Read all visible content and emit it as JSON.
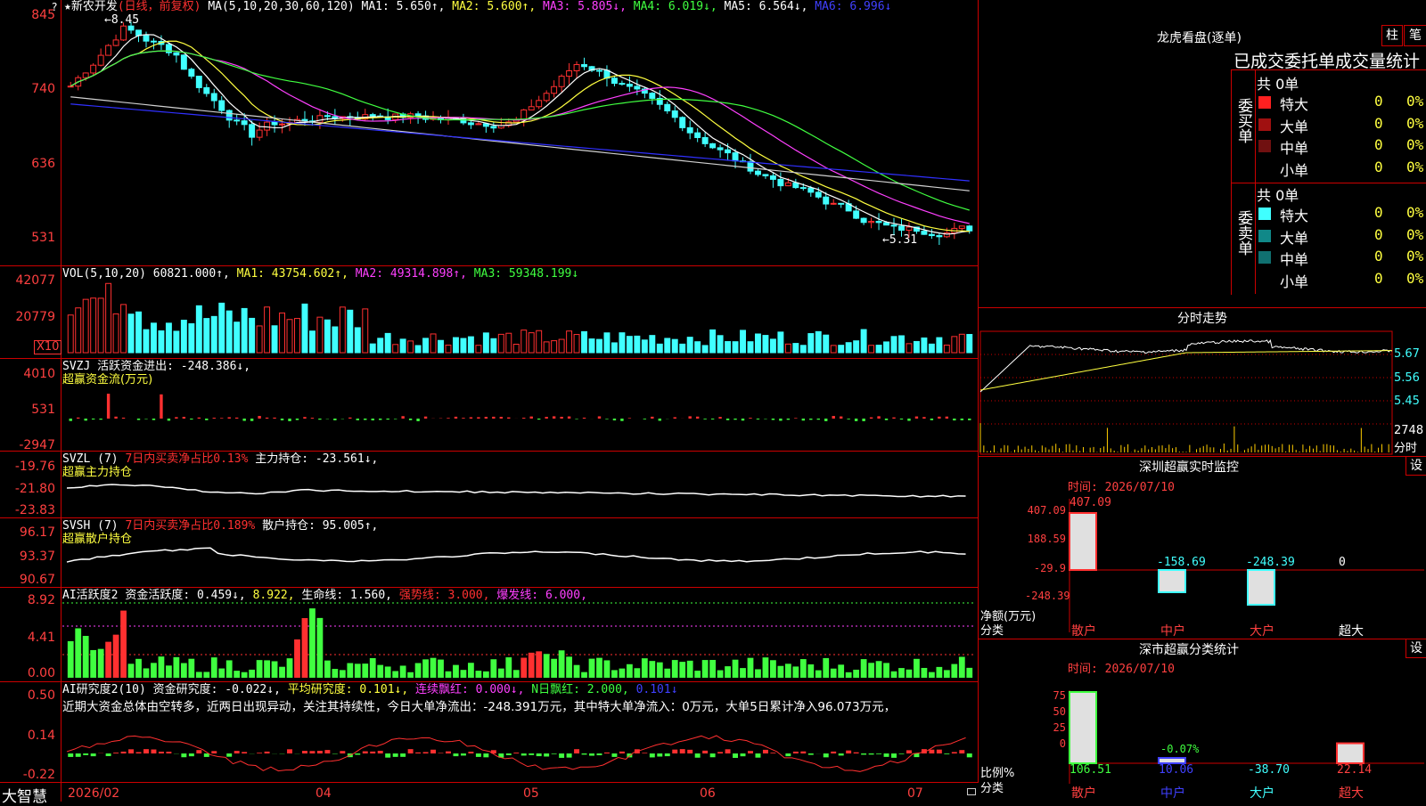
{
  "app": {
    "logo": "大智慧",
    "lock_icon": "lock-icon"
  },
  "header": {
    "stock": "★新农开发",
    "period": "(日线，前复权)",
    "ma_label": "MA(5,10,20,30,60,120)",
    "ma1": "MA1: 5.650↑,",
    "ma2": "MA2: 5.600↑,",
    "ma3": "MA3: 5.805↓,",
    "ma4": "MA4: 6.019↓,",
    "ma5": "MA5: 6.564↓,",
    "ma6": "MA6: 6.996↓",
    "help": "?"
  },
  "price_panel": {
    "ticks": [
      "845",
      "740",
      "636",
      "531"
    ],
    "high_label": "←8.45",
    "low_label": "←5.31"
  },
  "vol_panel": {
    "title": "VOL(5,10,20)",
    "value": "60821.000↑,",
    "ma1": "MA1: 43754.602↑,",
    "ma2": "MA2: 49314.898↑,",
    "ma3": "MA3: 59348.199↓",
    "ticks": [
      "42077",
      "20779"
    ],
    "unit": "X10"
  },
  "svzj": {
    "title": "SVZJ",
    "desc": "活跃资金进出: -248.386↓,",
    "sub": "超赢资金流(万元)",
    "ticks": [
      "4010",
      "531",
      "-2947"
    ]
  },
  "svzl": {
    "title": "SVZL (7)",
    "desc": "7日内买卖净占比0.13%",
    "value": "主力持仓: -23.561↓,",
    "sub": "超赢主力持仓",
    "ticks": [
      "-19.76",
      "-21.80",
      "-23.83"
    ]
  },
  "svsh": {
    "title": "SVSH (7)",
    "desc": "7日内买卖净占比0.189%",
    "value": "散户持仓: 95.005↑,",
    "sub": "超赢散户持仓",
    "ticks": [
      "96.17",
      "93.37",
      "90.67"
    ]
  },
  "ai_act": {
    "title": "AI活跃度2",
    "a": "资金活跃度: 0.459↓,",
    "b": "8.922,",
    "c": "生命线: 1.560,",
    "d": "强势线: 3.000,",
    "e": "爆发线: 6.000,",
    "ticks": [
      "8.92",
      "4.41",
      "0.00"
    ]
  },
  "ai_res": {
    "title": "AI研究度2(10)",
    "a": "资金研究度: -0.022↓,",
    "b": "平均研究度: 0.101↓,",
    "c": "连续飘红: 0.000↓,",
    "d": "N日飘红: 2.000,",
    "e": "0.101↓",
    "note": "近期大资金总体由空转多，近两日出现异动，关注其持续性，今日大单净流出：-248.391万元，其中特大单净流入：0万元，大单5日累计净入96.073万元，",
    "ticks": [
      "0.50",
      "0.14",
      "-0.22"
    ]
  },
  "xaxis": [
    "2026/02",
    "04",
    "05",
    "06",
    "07"
  ],
  "lhb": {
    "title": "龙虎看盘(逐单)",
    "btn1": "柱",
    "btn2": "笔",
    "heading": "已成交委托单成交量统计",
    "buy_side": "委买单",
    "sell_side": "委卖单",
    "buy_total": "共 0单",
    "sell_total": "共 0单",
    "rows": [
      "特大",
      "大单",
      "中单",
      "小单"
    ],
    "zero": "0",
    "pct": "0%"
  },
  "fenshi": {
    "title": "分时走势",
    "ticks": [
      "5.67",
      "5.56",
      "5.45"
    ],
    "vol": "2748",
    "vol_unit": "分时"
  },
  "szmon": {
    "title": "深圳超赢实时监控",
    "btn": "设",
    "time": "时间: 2026/07/10",
    "ticks": [
      "407.09",
      "188.59",
      "-29.9",
      "-248.39"
    ],
    "vals": [
      "407.09",
      "-158.69",
      "-248.39",
      "0"
    ],
    "ylabel": "净额(万元)",
    "xlabel": "分类",
    "cats": [
      "散户",
      "中户",
      "大户",
      "超大"
    ]
  },
  "szcls": {
    "title": "深市超赢分类统计",
    "btn": "设",
    "time": "时间: 2026/07/10",
    "ticks": [
      "75",
      "50",
      "25",
      "0"
    ],
    "vals": [
      "106.51",
      "10.06",
      "-38.70",
      "22.14"
    ],
    "pct_label": "-0.07%",
    "ylabel": "比例%",
    "xlabel": "分类",
    "cats": [
      "散户",
      "中户",
      "大户",
      "超大"
    ]
  },
  "colors": {
    "up": "#ff3030",
    "down": "#40ffff",
    "grid": "#c00000"
  }
}
